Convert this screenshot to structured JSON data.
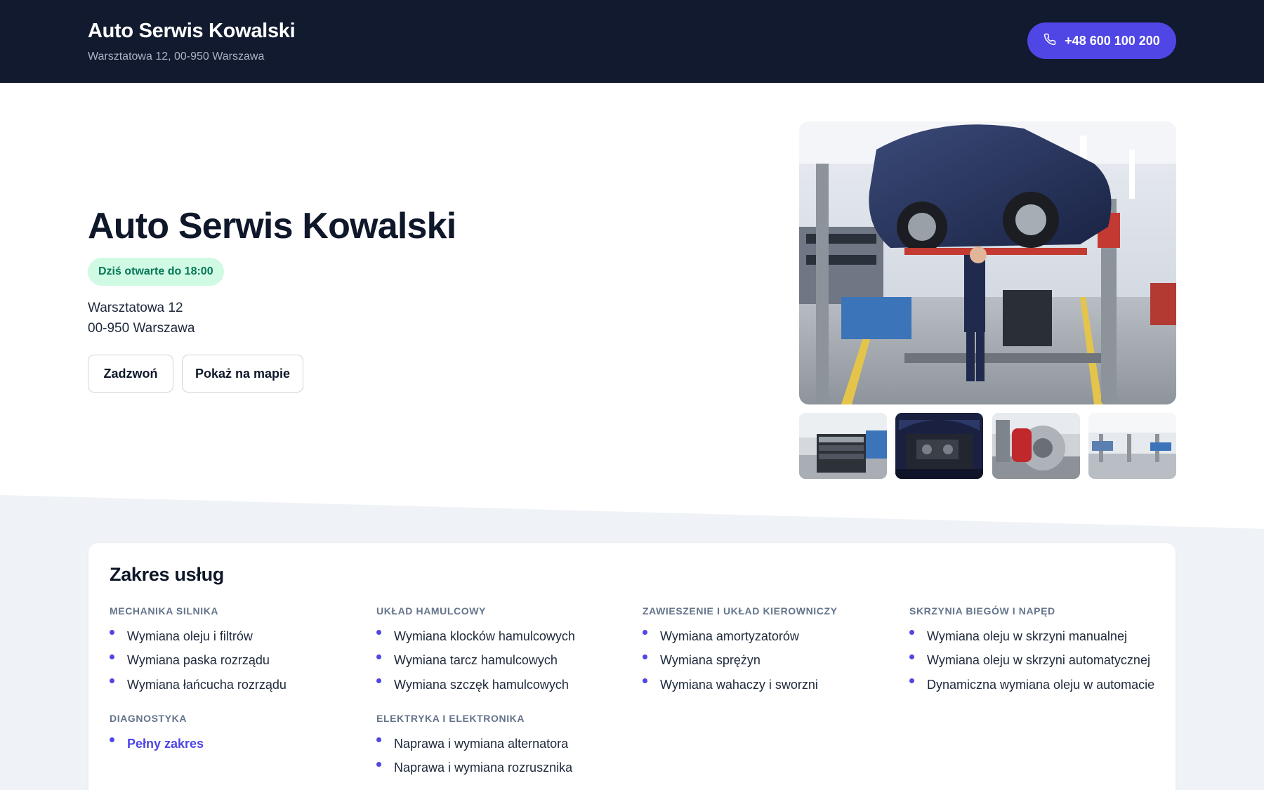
{
  "header": {
    "title": "Auto Serwis Kowalski",
    "address": "Warsztatowa 12, 00-950 Warszawa",
    "phone": "+48 600 100 200",
    "phone_icon": "phone-icon"
  },
  "hero": {
    "title": "Auto Serwis Kowalski",
    "open_status": "Dziś otwarte do 18:00",
    "address_line1": "Warsztatowa 12",
    "address_line2": "00-950 Warszawa",
    "call_label": "Zadzwoń",
    "map_label": "Pokaż na mapie"
  },
  "gallery": {
    "main": "car-lift-workshop-photo",
    "thumbnails": [
      "tool-cart-photo",
      "engine-bay-photo",
      "brake-disc-photo",
      "workshop-hall-photo"
    ]
  },
  "services": {
    "title": "Zakres usług",
    "categories": [
      {
        "name": "MECHANIKA SILNIKA",
        "items": [
          "Wymiana oleju i filtrów",
          "Wymiana paska rozrządu",
          "Wymiana łańcucha rozrządu"
        ]
      },
      {
        "name": "UKŁAD HAMULCOWY",
        "items": [
          "Wymiana klocków hamulcowych",
          "Wymiana tarcz hamulcowych",
          "Wymiana szczęk hamulcowych"
        ]
      },
      {
        "name": "ZAWIESZENIE I UKŁAD KIEROWNICZY",
        "items": [
          "Wymiana amortyzatorów",
          "Wymiana sprężyn",
          "Wymiana wahaczy i sworzni"
        ]
      },
      {
        "name": "SKRZYNIA BIEGÓW I NAPĘD",
        "items": [
          "Wymiana oleju w skrzyni manualnej",
          "Wymiana oleju w skrzyni automatycznej",
          "Dynamiczna wymiana oleju w automacie"
        ]
      },
      {
        "name": "DIAGNOSTYKA",
        "items": [
          "Pełny zakres"
        ]
      },
      {
        "name": "ELEKTRYKA I ELEKTRONIKA",
        "items": [
          "Naprawa i wymiana alternatora",
          "Naprawa i wymiana rozrusznika"
        ]
      }
    ]
  },
  "colors": {
    "header_bg": "#111a2e",
    "accent": "#4f46e5",
    "badge_bg": "#d1fae5",
    "badge_text": "#047857",
    "section_bg": "#eff2f6"
  }
}
